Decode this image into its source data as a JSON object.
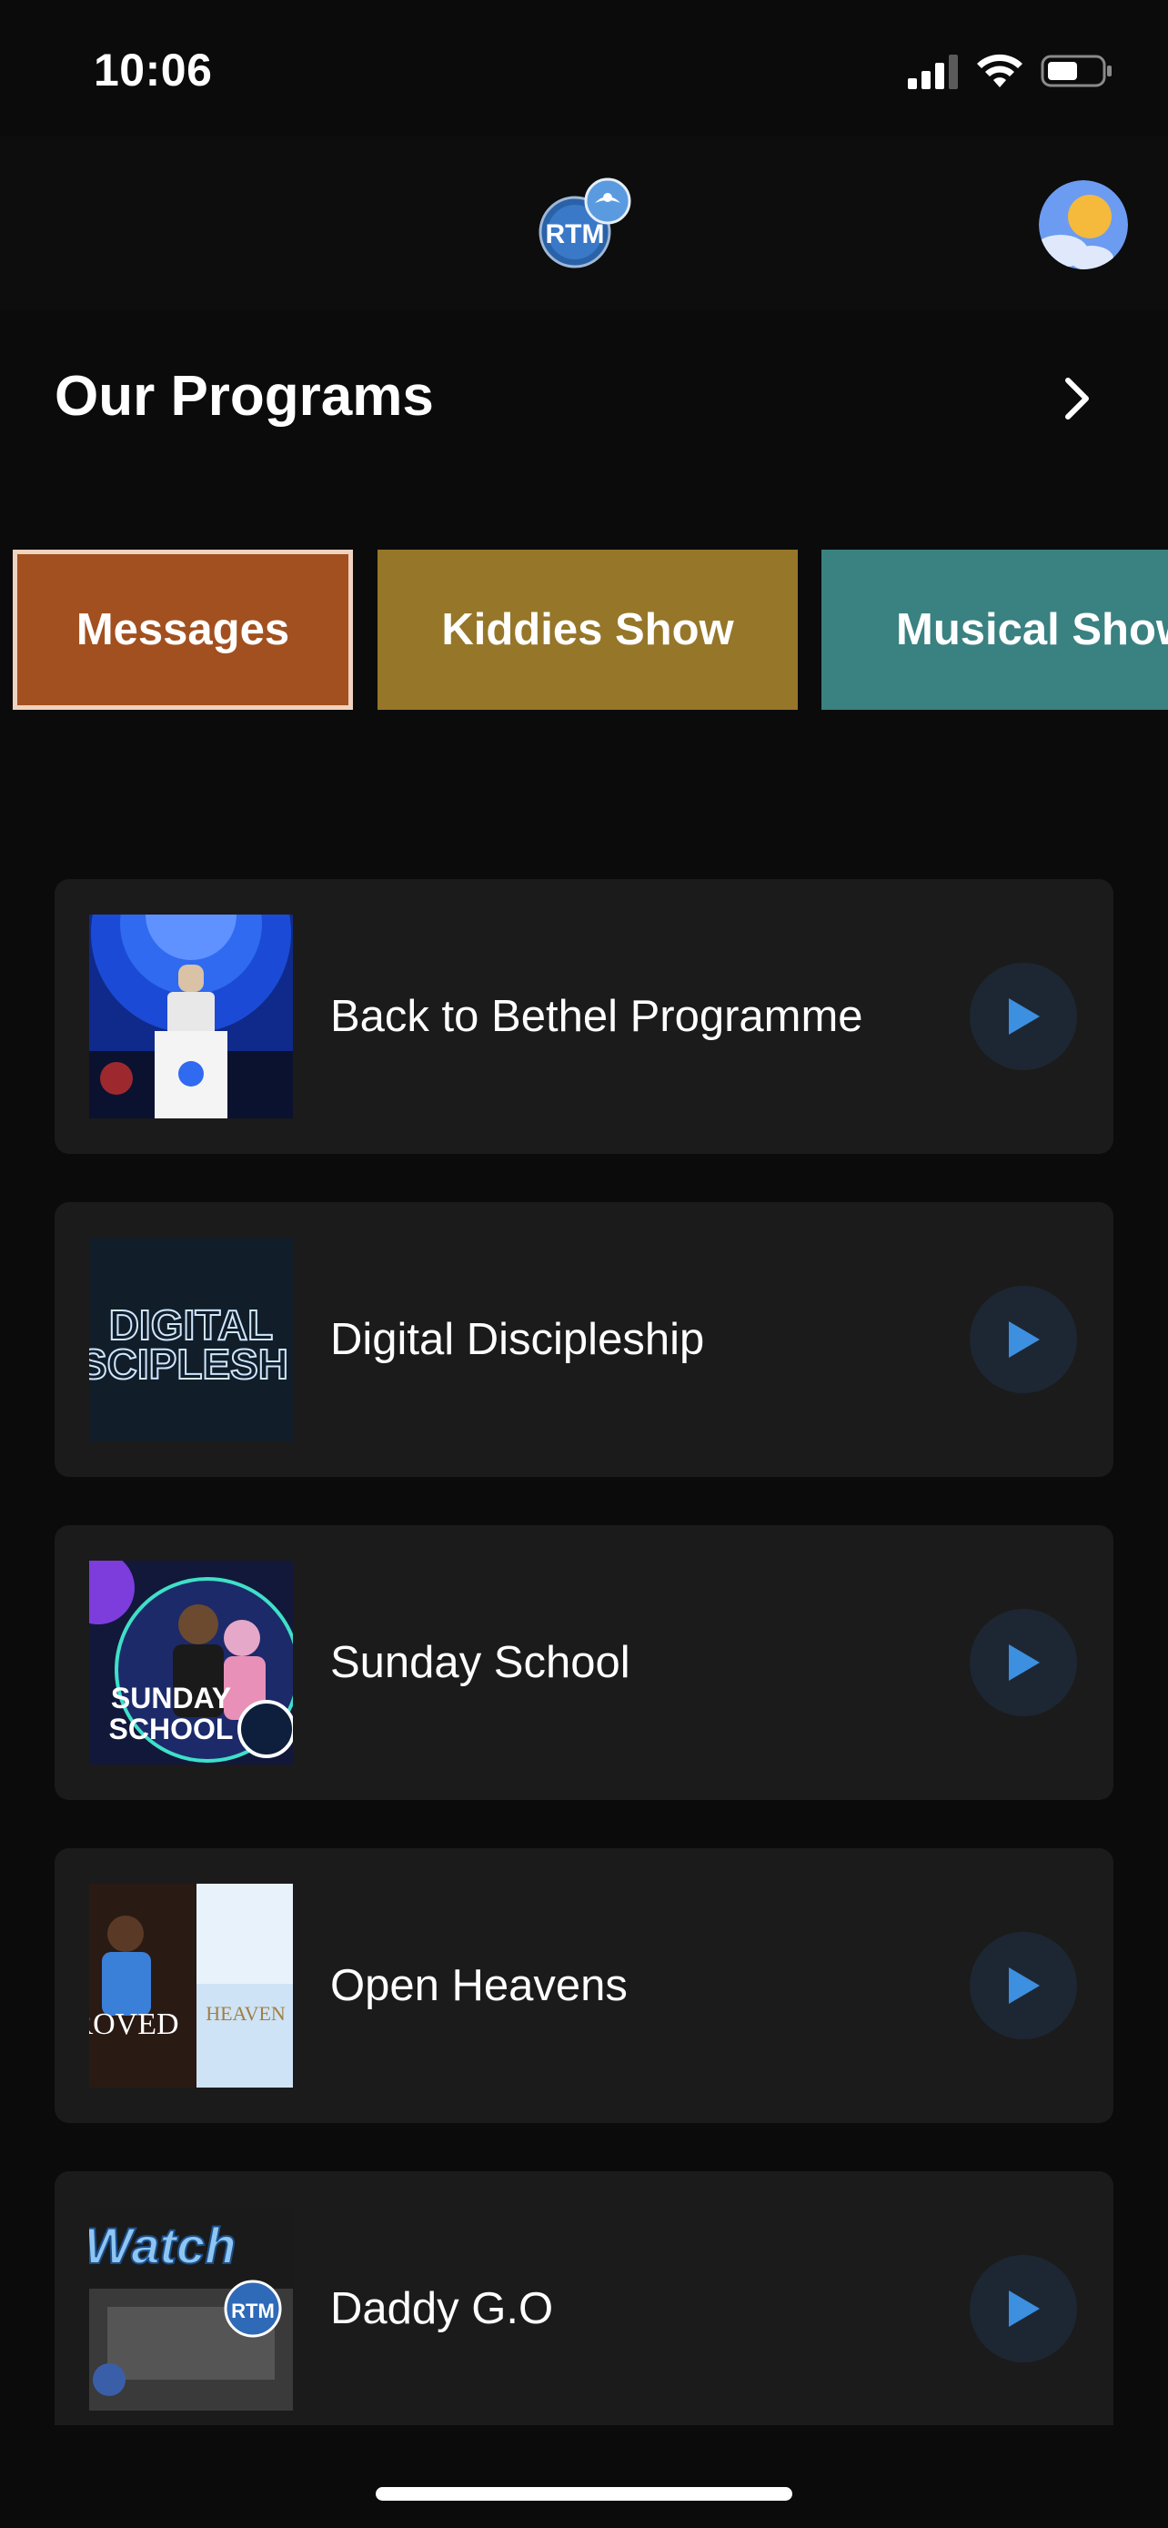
{
  "status_bar": {
    "time": "10:06"
  },
  "header": {
    "logo_text": "RTM",
    "avatar_icon": "sun-avatar-icon"
  },
  "section": {
    "title": "Our Programs",
    "chevron_icon": "chevron-right-icon"
  },
  "categories": [
    {
      "label": "Messages",
      "color": "#a2501f",
      "selected": true
    },
    {
      "label": "Kiddies Show",
      "color": "#967628",
      "selected": false
    },
    {
      "label": "Musical Show",
      "color": "#3a8181",
      "selected": false
    }
  ],
  "programs": [
    {
      "title": "Back to Bethel Programme"
    },
    {
      "title": "Digital Discipleship",
      "thumb_text": "DIGITAL DISCIPLESHI"
    },
    {
      "title": "Sunday School",
      "thumb_text": "SUNDAY SCHOOL"
    },
    {
      "title": "Open Heavens",
      "thumb_text": "ROVED..."
    },
    {
      "title": "Daddy G.O",
      "thumb_text": "Watch"
    }
  ],
  "colors": {
    "background": "#0b0b0b",
    "card": "#1b1b1b",
    "play_bg": "#1d2733",
    "play_accent": "#3d8fe0"
  }
}
